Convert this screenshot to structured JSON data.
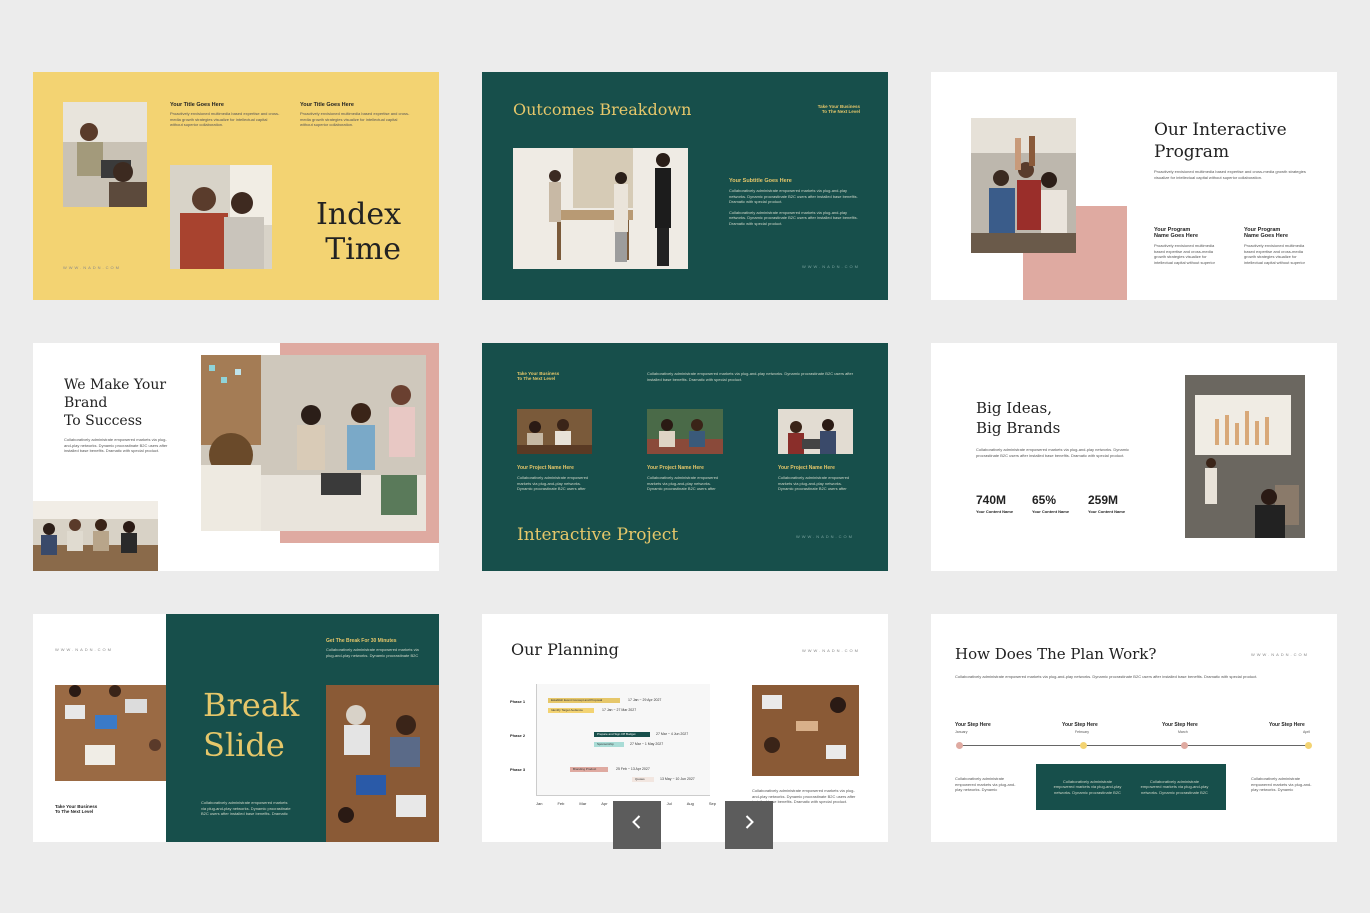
{
  "colors": {
    "yellow": "#f3d372",
    "teal": "#174f4b",
    "pink": "#dfaaa1",
    "gold": "#e6c76a",
    "bg": "#ececec"
  },
  "url": "WWW.NADN.COM",
  "lorem_short": "Proactively envisioned multimedia based expertise and cross-media growth strategies visualize for intellectual capital without superior collaboration.",
  "lorem_long": "Collaboratively administrate empowered markets via plug-and-play networks. Dynamic procrastinate B2C users after installed base benefits. Dramatic with special product.",
  "s1": {
    "title1": "Your Title Goes Here",
    "title2": "Your Title Goes Here",
    "big1": "Index",
    "big2": "Time"
  },
  "s2": {
    "title": "Outcomes Breakdown",
    "tag1": "Take Your Business",
    "tag2": "To The Next Level",
    "subtitle": "Your Subtitle Goes Here"
  },
  "s3": {
    "title1": "Our Interactive",
    "title2": "Program",
    "p1a": "Your Program",
    "p1b": "Name Goes Here",
    "p2a": "Your Program",
    "p2b": "Name Goes Here"
  },
  "s4": {
    "t1": "We Make Your",
    "t2": "Brand",
    "t3": "To Success"
  },
  "s5": {
    "tag1": "Take Your Business",
    "tag2": "To The Next Level",
    "items": [
      "Your Project Name Here",
      "Your Project Name Here",
      "Your Project Name Here"
    ],
    "title": "Interactive Project"
  },
  "s6": {
    "t1": "Big Ideas,",
    "t2": "Big Brands",
    "stats": [
      {
        "value": "740M",
        "label": "Your Content Name"
      },
      {
        "value": "65%",
        "label": "Your Content Name"
      },
      {
        "value": "259M",
        "label": "Your Content Name"
      }
    ]
  },
  "s7": {
    "t1": "Break",
    "t2": "Slide",
    "get": "Get The Break For 30 Minutes",
    "tag1": "Take Your Business",
    "tag2": "To The Next Level"
  },
  "s8": {
    "title": "Our Planning",
    "phases": [
      "Phase 1",
      "Phase 2",
      "Phase 3"
    ],
    "months": [
      "Jan",
      "Feb",
      "Mar",
      "Apr",
      "May",
      "Jun",
      "Jul",
      "Aug",
      "Sep"
    ],
    "tasks": [
      {
        "label": "Establish Event Concept and Proposal",
        "date": "17 Jan ~ 29 Apr 2027",
        "color": "#e6c76a"
      },
      {
        "label": "Identify Target Audience",
        "date": "17 Jan ~ 27 Mar 2027",
        "color": "#f3d372"
      },
      {
        "label": "Prepare and Sign Off Budget",
        "date": "27 Mar ~ 4 Jun 2027",
        "color": "#174f4b"
      },
      {
        "label": "Sponsorship",
        "date": "27 Mar ~ 1 May 2027",
        "color": "#a9dcd6"
      },
      {
        "label": "Branding Product",
        "date": "25 Feb ~ 13 Apr 2027",
        "color": "#dfaaa1"
      },
      {
        "label": "Quotes",
        "date": "13 May ~ 10 Jun 2027",
        "color": "#f2e6e0"
      }
    ]
  },
  "s9": {
    "title": "How Does The Plan Work?",
    "steps": [
      {
        "label": "Your Step Here",
        "month": "January"
      },
      {
        "label": "Your Step Here",
        "month": "February"
      },
      {
        "label": "Your Step Here",
        "month": "March"
      },
      {
        "label": "Your Step Here",
        "month": "April"
      }
    ]
  },
  "nav": {
    "prev_icon": "chevron-left-icon",
    "next_icon": "chevron-right-icon"
  }
}
